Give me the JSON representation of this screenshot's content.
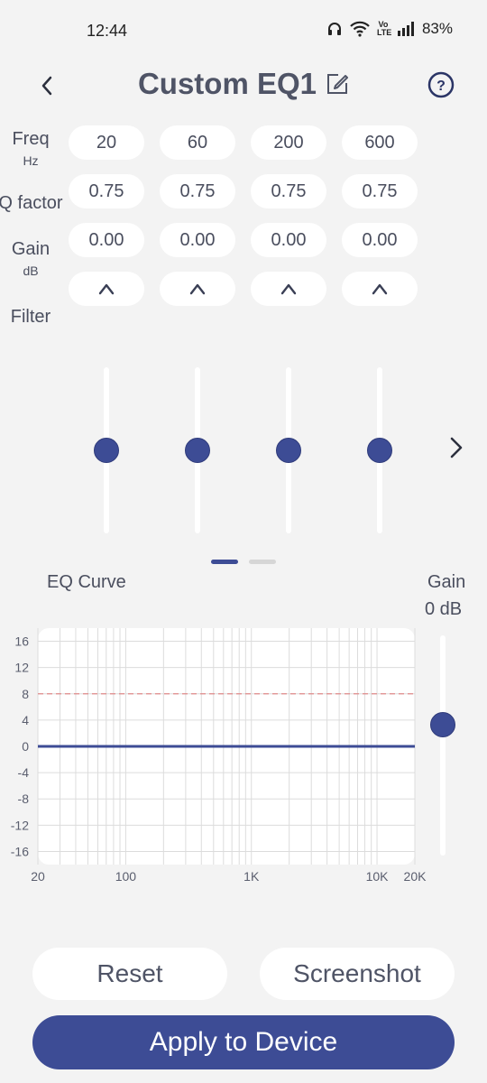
{
  "status": {
    "time": "12:44",
    "network_label": "Vo LTE",
    "battery": "83%",
    "icons": [
      "headphones-icon",
      "wifi-icon",
      "volte-icon",
      "signal-icon"
    ]
  },
  "header": {
    "title": "Custom EQ1",
    "icons": [
      "back-chevron-icon",
      "edit-icon",
      "help-icon"
    ]
  },
  "rows": {
    "freq": {
      "label": "Freq",
      "unit": "Hz"
    },
    "q": {
      "label": "Q factor"
    },
    "gain": {
      "label": "Gain",
      "unit": "dB"
    },
    "filter": {
      "label": "Filter"
    }
  },
  "bands": [
    {
      "freq": "20",
      "q": "0.75",
      "gain": "0.00",
      "filter_icon": "peak-filter-icon"
    },
    {
      "freq": "60",
      "q": "0.75",
      "gain": "0.00",
      "filter_icon": "peak-filter-icon"
    },
    {
      "freq": "200",
      "q": "0.75",
      "gain": "0.00",
      "filter_icon": "peak-filter-icon"
    },
    {
      "freq": "600",
      "q": "0.75",
      "gain": "0.00",
      "filter_icon": "peak-filter-icon"
    }
  ],
  "band_slider_levels": [
    0,
    0,
    0,
    0
  ],
  "eq_curve": {
    "label": "EQ Curve",
    "gain_title": "Gain",
    "gain_value": "0 dB",
    "gain_level": 0
  },
  "chart_data": {
    "type": "line",
    "x_scale": "log",
    "xlim": [
      20,
      20000
    ],
    "ylim": [
      -18,
      18
    ],
    "x_tick_labels": [
      {
        "value": 20,
        "label": "20"
      },
      {
        "value": 100,
        "label": "100"
      },
      {
        "value": 1000,
        "label": "1K"
      },
      {
        "value": 10000,
        "label": "10K"
      },
      {
        "value": 20000,
        "label": "20K"
      }
    ],
    "y_ticks": [
      16,
      12,
      8,
      4,
      0,
      -4,
      -8,
      -12,
      -16
    ],
    "y_tick_labels": [
      "16",
      "12",
      "8",
      "4",
      "0",
      "-4",
      "-8",
      "-12",
      "-16"
    ],
    "series": [
      {
        "x": [
          20,
          20000
        ],
        "y": [
          0,
          0
        ],
        "color": "#3d4c95"
      }
    ],
    "reference_line": {
      "y": 8,
      "style": "dashed",
      "color": "#e08a8a"
    },
    "grid": true
  },
  "buttons": {
    "reset": "Reset",
    "screenshot": "Screenshot",
    "apply": "Apply to Device"
  },
  "pager": {
    "pages": 2,
    "active": 0
  },
  "colors": {
    "accent": "#3d4c95",
    "background": "#f3f3f3",
    "text": "#4a4e5e",
    "pager_inactive": "#d6d6d6",
    "reference_line": "#e08a8a"
  }
}
